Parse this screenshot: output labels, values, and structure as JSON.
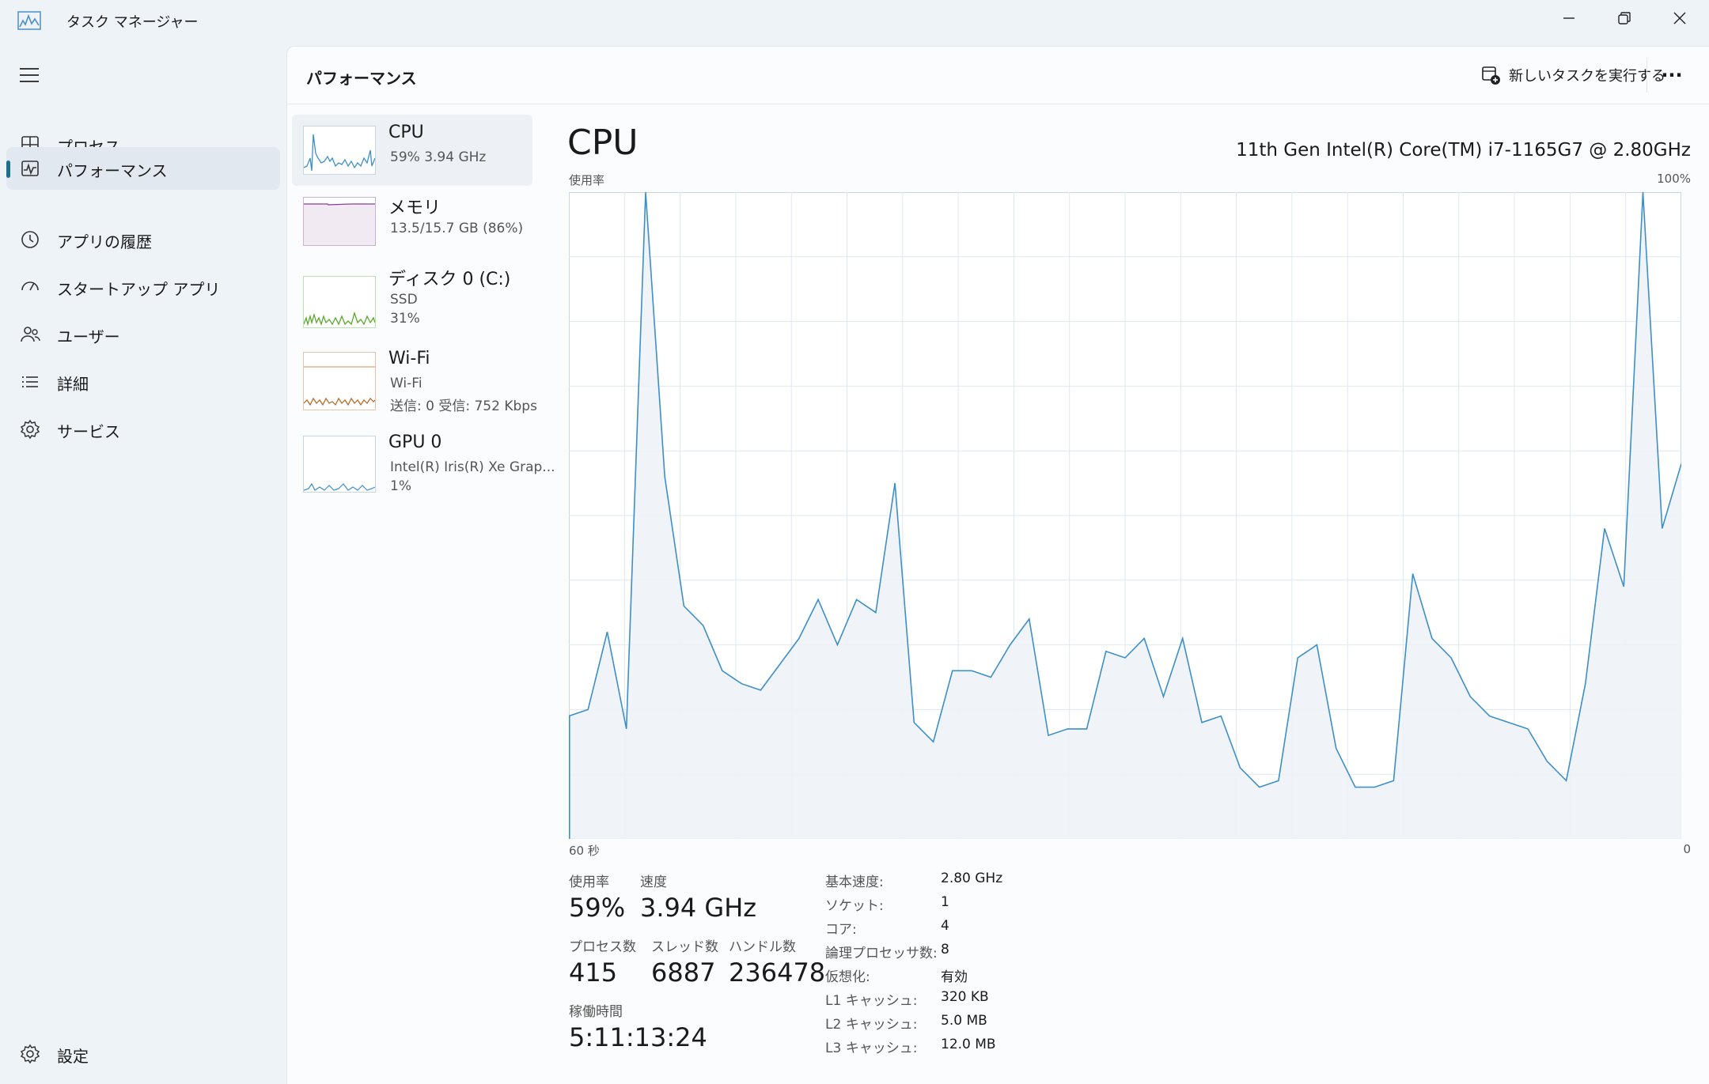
{
  "app": {
    "title": "タスク マネージャー"
  },
  "sidebar": {
    "items": [
      {
        "label": "プロセス",
        "icon": "processes-icon"
      },
      {
        "label": "パフォーマンス",
        "icon": "performance-icon",
        "active": true
      },
      {
        "label": "アプリの履歴",
        "icon": "history-icon"
      },
      {
        "label": "スタートアップ アプリ",
        "icon": "startup-icon"
      },
      {
        "label": "ユーザー",
        "icon": "users-icon"
      },
      {
        "label": "詳細",
        "icon": "details-icon"
      },
      {
        "label": "サービス",
        "icon": "services-icon"
      }
    ],
    "settings_label": "設定"
  },
  "header": {
    "title": "パフォーマンス",
    "run_task_label": "新しいタスクを実行する",
    "more_label": "···"
  },
  "devices": [
    {
      "name": "CPU",
      "line1": "59%  3.94 GHz",
      "line2": ""
    },
    {
      "name": "メモリ",
      "line1": "13.5/15.7 GB (86%)",
      "line2": ""
    },
    {
      "name": "ディスク 0 (C:)",
      "line1": "SSD",
      "line2": "31%"
    },
    {
      "name": "Wi-Fi",
      "line1": "Wi-Fi",
      "line2": "送信: 0  受信: 752 Kbps"
    },
    {
      "name": "GPU 0",
      "line1": "Intel(R) Iris(R) Xe Grap...",
      "line2": "1%"
    }
  ],
  "detail": {
    "title": "CPU",
    "model": "11th Gen Intel(R) Core(TM) i7-1165G7 @ 2.80GHz",
    "y_axis_label": "使用率",
    "y_max_label": "100%",
    "x_left_label": "60 秒",
    "x_right_label": "0"
  },
  "stats": {
    "usage_label": "使用率",
    "usage_value": "59%",
    "speed_label": "速度",
    "speed_value": "3.94 GHz",
    "processes_label": "プロセス数",
    "processes_value": "415",
    "threads_label": "スレッド数",
    "threads_value": "6887",
    "handles_label": "ハンドル数",
    "handles_value": "236478",
    "uptime_label": "稼働時間",
    "uptime_value": "5:11:13:24"
  },
  "specs": [
    {
      "label": "基本速度:",
      "value": "2.80 GHz"
    },
    {
      "label": "ソケット:",
      "value": "1"
    },
    {
      "label": "コア:",
      "value": "4"
    },
    {
      "label": "論理プロセッサ数:",
      "value": "8"
    },
    {
      "label": "仮想化:",
      "value": "有効"
    },
    {
      "label": "L1 キャッシュ:",
      "value": "320 KB"
    },
    {
      "label": "L2 キャッシュ:",
      "value": "5.0 MB"
    },
    {
      "label": "L3 キャッシュ:",
      "value": "12.0 MB"
    }
  ],
  "chart_data": {
    "type": "area",
    "ylim": [
      0,
      100
    ],
    "x_direction": "60 seconds ago to now",
    "color": "#3d8fc7",
    "fill": "#eef3f8",
    "values": [
      19,
      20,
      32,
      17,
      100,
      56,
      36,
      33,
      26,
      24,
      23,
      27,
      31,
      37,
      30,
      37,
      35,
      55,
      18,
      15,
      26,
      26,
      25,
      30,
      34,
      16,
      17,
      17,
      29,
      28,
      31,
      22,
      31,
      18,
      19,
      11,
      8,
      9,
      28,
      30,
      14,
      8,
      8,
      9,
      41,
      31,
      28,
      22,
      19,
      18,
      17,
      12,
      9,
      24,
      48,
      39,
      100,
      48,
      58
    ]
  }
}
